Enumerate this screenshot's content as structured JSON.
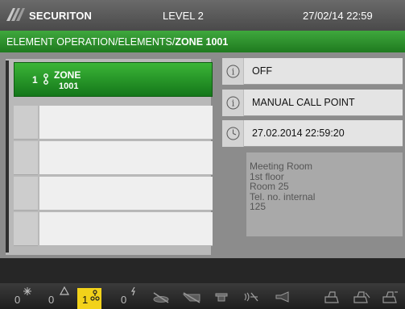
{
  "titlebar": {
    "brand": "SECURITON",
    "level": "LEVEL 2",
    "datetime": "27/02/14 22:59"
  },
  "breadcrumb": {
    "path": "ELEMENT OPERATION/ELEMENTS/",
    "current": "ZONE 1001"
  },
  "zone_list": {
    "selected": {
      "number": "1",
      "icon": "device-icon",
      "line1": "ZONE",
      "line2": "1001"
    },
    "empty_rows": 4
  },
  "details": {
    "status": {
      "icon": "info-icon",
      "text": "OFF"
    },
    "type": {
      "icon": "info-icon",
      "text": "MANUAL CALL POINT"
    },
    "timestamp": {
      "icon": "clock-icon",
      "text": "27.02.2014 22:59:20"
    },
    "description": [
      "Meeting Room",
      "1st floor",
      "Room 25",
      "Tel. no. internal",
      "125"
    ]
  },
  "statusbar": {
    "items": [
      {
        "count": "0",
        "icon": "fire-alarm-icon"
      },
      {
        "count": "0",
        "icon": "warning-triangle-icon"
      },
      {
        "count": "1",
        "icon": "disablement-icon",
        "highlighted": true,
        "highlight_color": "#f2d21a"
      },
      {
        "count": "0",
        "icon": "fault-icon"
      },
      {
        "count": "",
        "icon": "detector-off-icon"
      },
      {
        "count": "",
        "icon": "zone-off-icon"
      },
      {
        "count": "",
        "icon": "control-off-icon"
      },
      {
        "count": "",
        "icon": "transmission-off-icon"
      },
      {
        "count": "",
        "icon": "sounder-off-icon"
      },
      {
        "count": "",
        "icon": "print-off-icon"
      },
      {
        "count": "",
        "icon": "print-alt-off-icon"
      },
      {
        "count": "",
        "icon": "printer-icon"
      }
    ]
  },
  "colors": {
    "header_green": "#2e9a2c",
    "selected_green": "#1f8a22",
    "highlight_yellow": "#f2d21a"
  }
}
